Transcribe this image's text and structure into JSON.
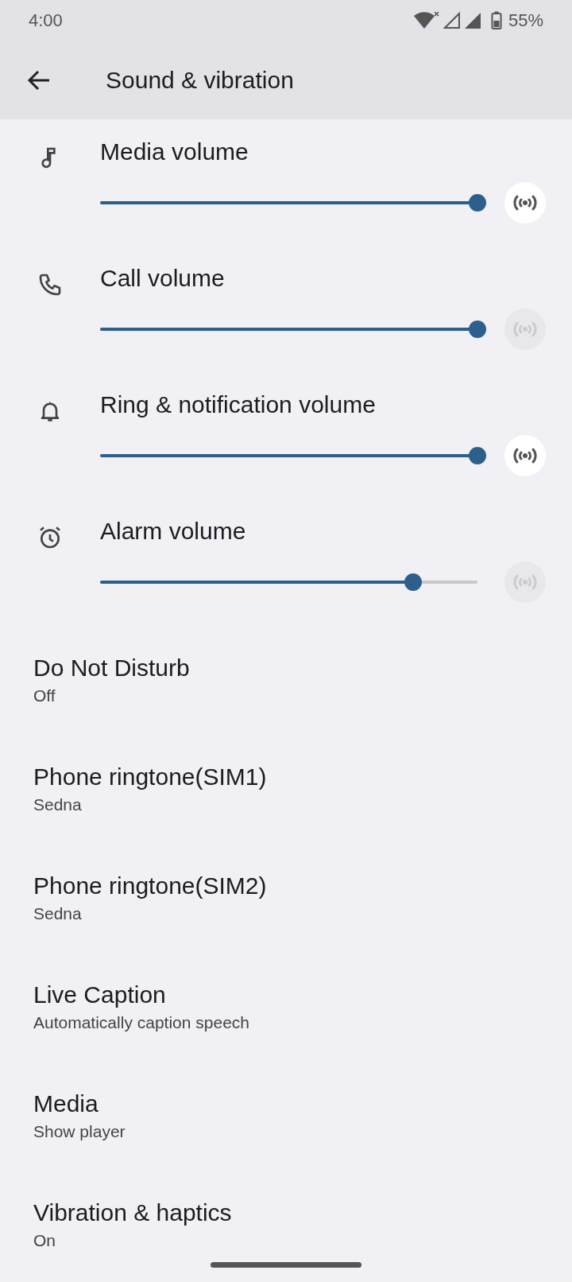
{
  "status_bar": {
    "time": "4:00",
    "battery": "55%"
  },
  "toolbar": {
    "title": "Sound & vibration"
  },
  "volumes": [
    {
      "kind": "music",
      "label": "Media volume",
      "level": 1.0,
      "cast_enabled": true
    },
    {
      "kind": "phone",
      "label": "Call volume",
      "level": 1.0,
      "cast_enabled": false
    },
    {
      "kind": "bell",
      "label": "Ring & notification volume",
      "level": 1.0,
      "cast_enabled": true
    },
    {
      "kind": "alarm",
      "label": "Alarm volume",
      "level": 0.83,
      "cast_enabled": false
    }
  ],
  "settings": [
    {
      "title": "Do Not Disturb",
      "summary": "Off"
    },
    {
      "title": "Phone ringtone(SIM1)",
      "summary": "Sedna"
    },
    {
      "title": "Phone ringtone(SIM2)",
      "summary": "Sedna"
    },
    {
      "title": "Live Caption",
      "summary": "Automatically caption speech"
    },
    {
      "title": "Media",
      "summary": "Show player"
    },
    {
      "title": "Vibration & haptics",
      "summary": "On"
    }
  ]
}
